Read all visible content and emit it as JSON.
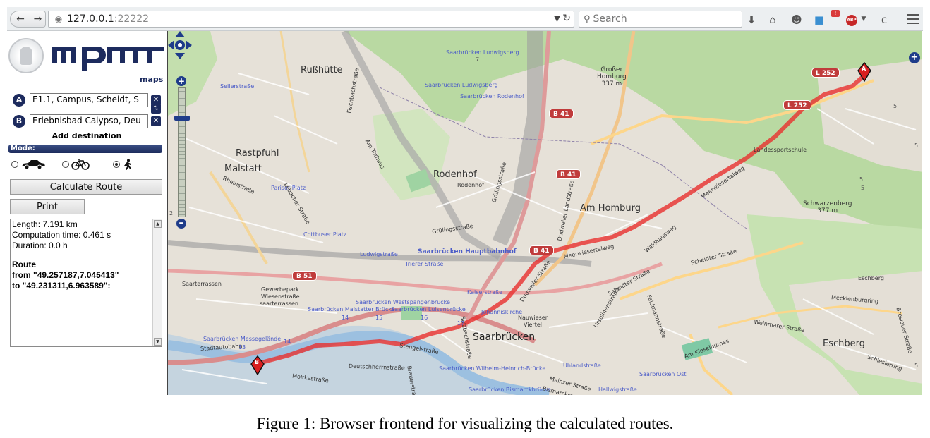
{
  "browser": {
    "url_host": "127.0.0.1",
    "url_port": ":22222",
    "search_placeholder": "Search",
    "badge_count": "!",
    "abp_label": "ABP"
  },
  "sidebar": {
    "logo_text": "maps",
    "stops": [
      {
        "letter": "A",
        "value": "E1.1, Campus, Scheidt, S"
      },
      {
        "letter": "B",
        "value": "Erlebnisbad Calypso, Deu"
      }
    ],
    "add_destination": "Add destination",
    "mode_label": "Mode:",
    "modes": [
      {
        "name": "car",
        "icon": "car-icon",
        "selected": false
      },
      {
        "name": "bike",
        "icon": "bicycle-icon",
        "selected": false
      },
      {
        "name": "walk",
        "icon": "pedestrian-icon",
        "selected": true
      }
    ],
    "calculate_label": "Calculate Route",
    "print_label": "Print",
    "result": {
      "length": "Length: 7.191 km",
      "computation_time": "Computation time: 0.461 s",
      "duration": "Duration: 0.0 h",
      "route_heading": "Route",
      "route_from": "from \"49.257187,7.045413\"",
      "route_to": "to \"49.231311,6.963589\":"
    }
  },
  "map": {
    "districts": [
      {
        "text": "Rußhütte",
        "cls": "lbl-district"
      },
      {
        "text": "Rastpfuhl",
        "cls": "lbl-district"
      },
      {
        "text": "Malstatt",
        "cls": "lbl-district"
      },
      {
        "text": "Rodenhof",
        "cls": "lbl-district"
      },
      {
        "text": "Rodenhof",
        "cls": "lbl-street"
      },
      {
        "text": "Am Homburg",
        "cls": "lbl-district"
      },
      {
        "text": "Saarbrücken",
        "cls": "lbl-big"
      },
      {
        "text": "Eschberg",
        "cls": "lbl-district"
      },
      {
        "text": "Eschberg",
        "cls": "lbl-street"
      },
      {
        "text": "Saarterrassen",
        "cls": "lbl-street"
      },
      {
        "text": "Gewerbepark",
        "cls": "lbl-street"
      },
      {
        "text": "Wiesenstraße",
        "cls": "lbl-street"
      },
      {
        "text": "saarterrassen",
        "cls": "lbl-street"
      },
      {
        "text": "Nauwieser",
        "cls": "lbl-street"
      },
      {
        "text": "Viertel",
        "cls": "lbl-street"
      },
      {
        "text": "Landessportschule",
        "cls": "lbl-street"
      },
      {
        "text": "Saarbrücken Ost",
        "cls": "lbl-tram"
      }
    ],
    "peaks": [
      {
        "name": "Großer",
        "name2": "Homburg",
        "height": "337 m"
      },
      {
        "name": "Schwarzenberg",
        "name2": "",
        "height": "377 m"
      }
    ],
    "streets": [
      "Rheinstraße",
      "Lebacher Straße",
      "Am Torhaus",
      "Fischbachstraße",
      "Grülingsstraße",
      "Grülingsstraße",
      "Dudweiler Landstraße",
      "Dudweiler Straße",
      "Meerwiesertalweg",
      "Meerwiesertalweg",
      "Waldhausweg",
      "Scheidter Straße",
      "Scheidter Straße",
      "Weinmarer Straße",
      "Mecklenburgring",
      "Breslauer Straße",
      "Schlesierring",
      "Am Kieselhumes",
      "Deutschherrnstraße",
      "Moltkestraße",
      "Stadtautobahn",
      "Sulzbachstraße",
      "Mainzer Straße",
      "Bismarckstraße",
      "Ursulinenstraße",
      "Stengelstraße",
      "Brauerstraße",
      "Feldmannstraße"
    ],
    "tram_stops": [
      "Saarbrücken Ludwigsberg",
      "Saarbrücken Ludwigsberg",
      "Saarbrücken Rodenhof",
      "Saarbrücken Hauptbahnhof",
      "Ludwigstraße",
      "Trierer Straße",
      "Kaiserstraße",
      "Saarbrücken Westspangenbrücke",
      "Saarbrücken Malstatter Brücke",
      "Saarbrücken Luisenbrücke",
      "Johanniskirche",
      "Saarbrücken Wilhelm-Heinrich-Brücke",
      "Uhlandstraße",
      "Saarbrücken Messegelände",
      "Saarbrücken Bismarckbrücke",
      "Hallwigstraße",
      "Cottbuser Platz",
      "Pariser Platz",
      "Seilerstraße"
    ],
    "roads": [
      "B 41",
      "B 41",
      "B 41",
      "B 51",
      "L 252",
      "L 252"
    ],
    "numbers": [
      "7",
      "14",
      "15",
      "16",
      "17",
      "13",
      "14",
      "2",
      "5",
      "5",
      "5",
      "5",
      "5"
    ],
    "marker_a": "A",
    "marker_b": "B"
  },
  "colors": {
    "route": "#e8302e",
    "forest": "#b8d8a3",
    "urban": "#e5dfd7",
    "accent": "#1d2b5e"
  },
  "caption": "Figure 1: Browser frontend for visualizing the calculated routes."
}
